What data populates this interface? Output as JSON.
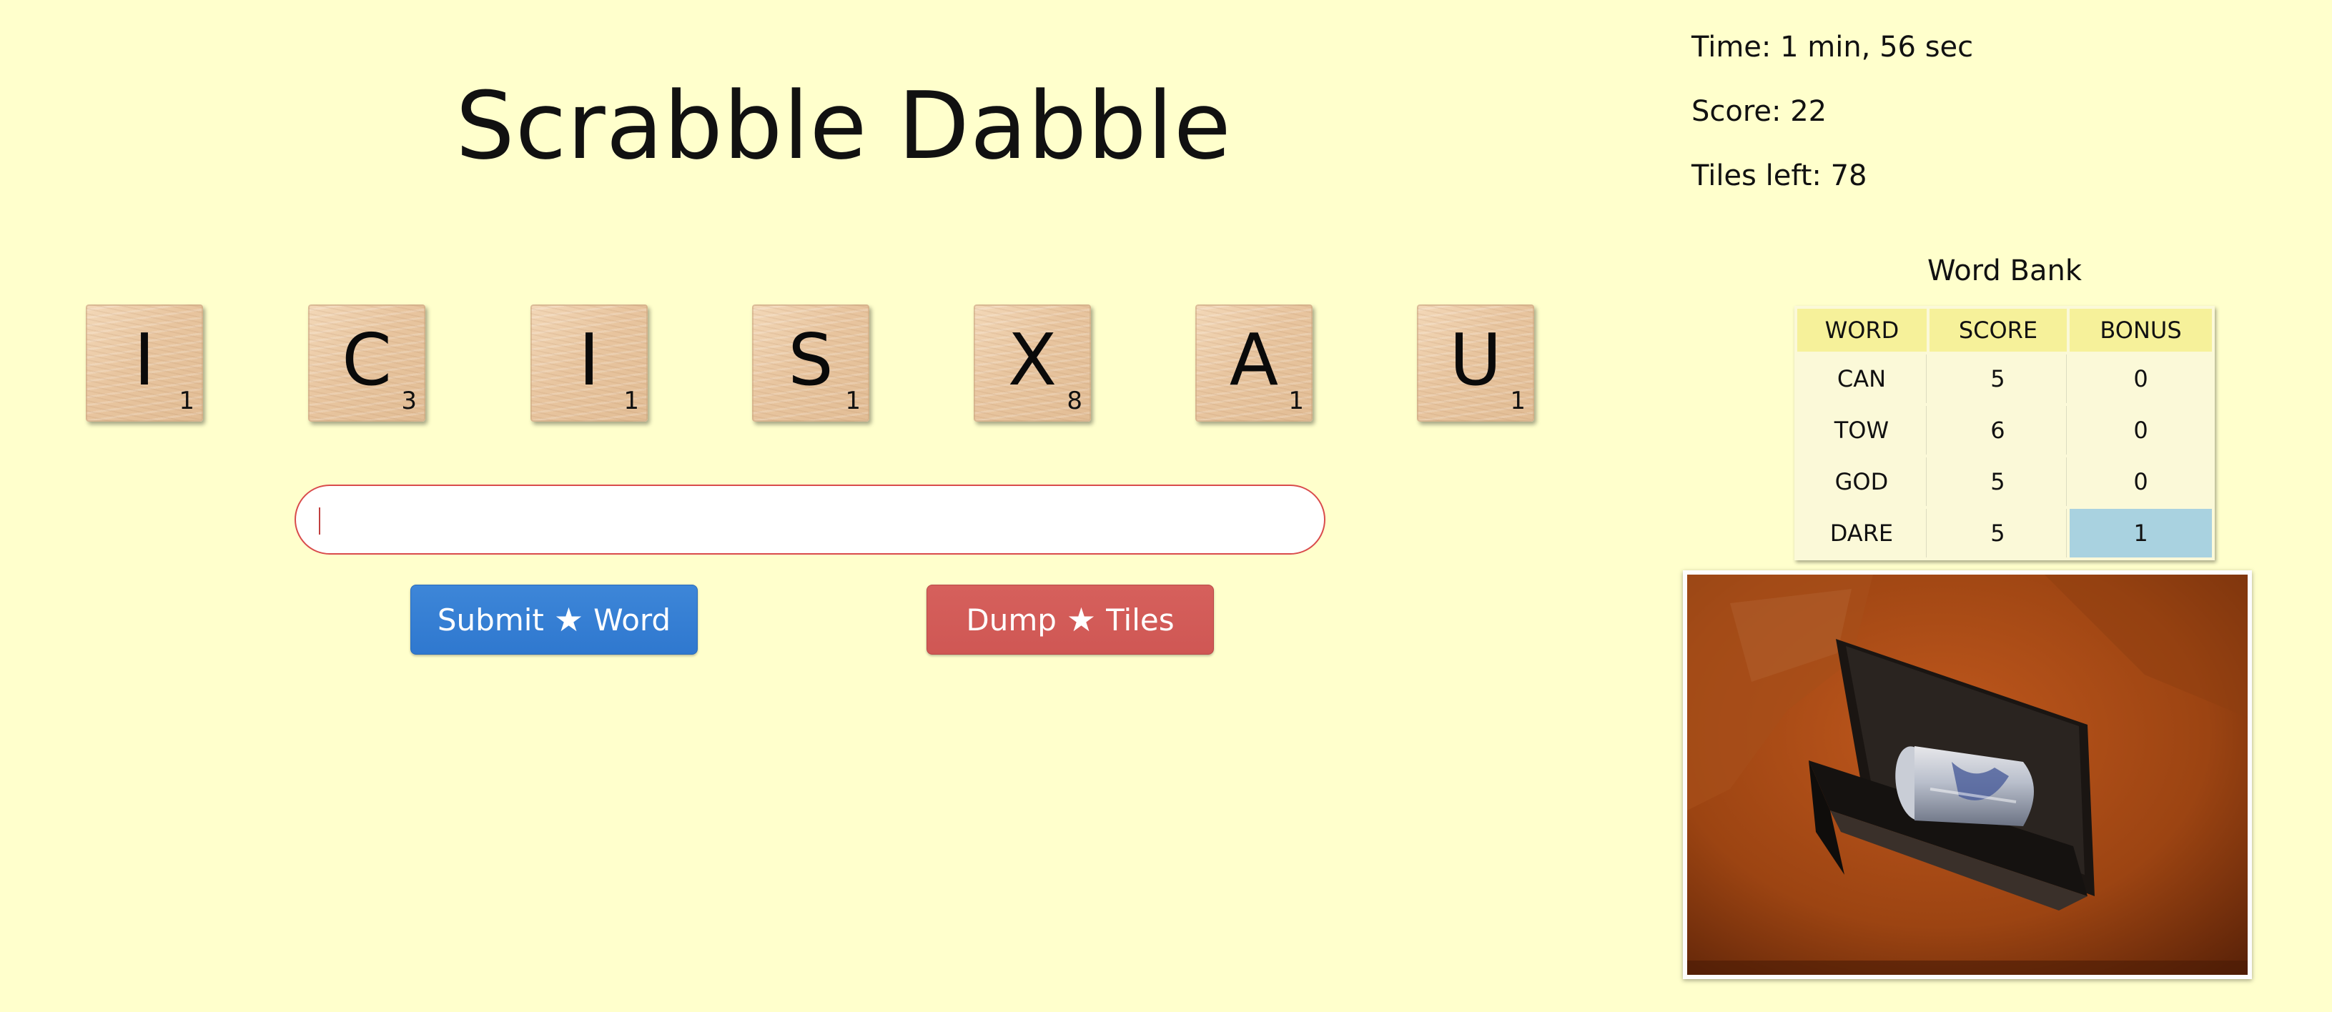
{
  "app": {
    "title": "Scrabble Dabble"
  },
  "stats": {
    "time": "Time: 1 min, 56 sec",
    "score": "Score: 22",
    "tiles_left": "Tiles left: 78"
  },
  "tiles": [
    {
      "letter": "I",
      "points": "1"
    },
    {
      "letter": "C",
      "points": "3"
    },
    {
      "letter": "I",
      "points": "1"
    },
    {
      "letter": "S",
      "points": "1"
    },
    {
      "letter": "X",
      "points": "8"
    },
    {
      "letter": "A",
      "points": "1"
    },
    {
      "letter": "U",
      "points": "1"
    }
  ],
  "word_input": {
    "value": "",
    "placeholder": ""
  },
  "buttons": {
    "submit": {
      "text1": "Submit",
      "text2": "Word",
      "icon": "star-icon"
    },
    "dump": {
      "text1": "Dump",
      "text2": "Tiles",
      "icon": "star-icon"
    }
  },
  "word_bank": {
    "title": "Word Bank",
    "headers": [
      "WORD",
      "SCORE",
      "BONUS"
    ],
    "rows": [
      [
        "CAN",
        "5",
        "0"
      ],
      [
        "TOW",
        "6",
        "0"
      ],
      [
        "GOD",
        "5",
        "0"
      ],
      [
        "DARE",
        "5",
        "1"
      ]
    ]
  },
  "photo": {
    "subject": "black-drawer-with-can-icon"
  },
  "colors": {
    "background": "#ffffcc",
    "submit_button": "#3b82d6",
    "dump_button": "#d45c59",
    "table_header": "#f6f19a",
    "bonus_highlight": "#a9d2e0"
  }
}
